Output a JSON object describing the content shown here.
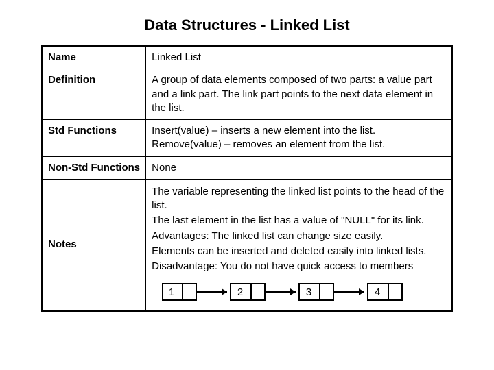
{
  "title": "Data Structures - Linked List",
  "rows": {
    "name": {
      "label": "Name",
      "value": "Linked List"
    },
    "definition": {
      "label": "Definition",
      "value": "A group of data elements composed of two parts:  a value part and a link part. The link part points to the next data element in the list."
    },
    "stdfns": {
      "label": "Std Functions",
      "line1": "Insert(value) – inserts a new element into the list.",
      "line2": "Remove(value) – removes an element from the list."
    },
    "nonstdfns": {
      "label": "Non-Std Functions",
      "value": "None"
    },
    "notes": {
      "label": "Notes",
      "p1": "The variable representing the linked list points to the head of the list.",
      "p2": "The last element in the list has a value of \"NULL\" for its link.",
      "p3": "Advantages:  The linked list can change size easily.",
      "p4": "Elements can be inserted and deleted easily into linked lists.",
      "p5": "Disadvantage:  You do not have quick access to members"
    }
  },
  "diagram": {
    "nodes": [
      "1",
      "2",
      "3",
      "4"
    ]
  }
}
